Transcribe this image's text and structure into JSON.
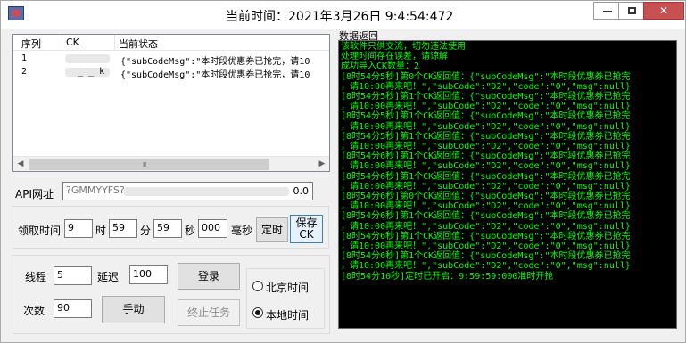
{
  "titlebar": {
    "title": "当前时间：2021年3月26日   9:4:54:472",
    "minimize_label": "",
    "maximize_label": "",
    "close_label": "✕"
  },
  "listview": {
    "columns": [
      "序列",
      "CK",
      "当前状态"
    ],
    "rows": [
      {
        "index": "1",
        "ck": "",
        "status": "{\"subCodeMsg\":\"本时段优惠券已抢完，请10"
      },
      {
        "index": "2",
        "ck": "_ _ k",
        "status": "{\"subCodeMsg\":\"本时段优惠券已抢完，请10"
      }
    ],
    "scroll_grip": "III"
  },
  "api": {
    "label": "API网址",
    "value_prefix": "?GMMYYFS?",
    "value_suffix": "0.0"
  },
  "timer": {
    "label": "领取时间",
    "hour_value": "9",
    "hour_unit": "时",
    "minute_value": "59",
    "minute_unit": "分",
    "second_value": "59",
    "second_unit": "秒",
    "ms_value": "000",
    "ms_unit": "毫秒",
    "timer_button": "定时",
    "save_button_line1": "保存",
    "save_button_line2": "CK"
  },
  "settings": {
    "thread_label": "线程",
    "thread_value": "5",
    "delay_label": "延迟",
    "delay_value": "100",
    "count_label": "次数",
    "count_value": "90",
    "login_button": "登录",
    "manual_button": "手动",
    "stop_button": "终止任务"
  },
  "time_source": {
    "beijing_label": "北京时间",
    "local_label": "本地时间",
    "selected": "local"
  },
  "console": {
    "title": "数据返回",
    "lines": [
      "该软件只供交流，切勿违法使用",
      "处理时间存在误差，请谅解",
      "成功导入CK数量：2",
      "[8时54分5秒]第0个CK返回值：{\"subCodeMsg\":\"本时段优惠券已抢完",
      "，请10:00再来吧！\",\"subCode\":\"D2\",\"code\":\"0\",\"msg\":null}",
      "[8时54分5秒]第1个CK返回值：{\"subCodeMsg\":\"本时段优惠券已抢完",
      "，请10:00再来吧！\",\"subCode\":\"D2\",\"code\":\"0\",\"msg\":null}",
      "[8时54分5秒]第1个CK返回值：{\"subCodeMsg\":\"本时段优惠券已抢完",
      "，请10:00再来吧！\",\"subCode\":\"D2\",\"code\":\"0\",\"msg\":null}",
      "[8时54分5秒]第1个CK返回值：{\"subCodeMsg\":\"本时段优惠券已抢完",
      "，请10:00再来吧！\",\"subCode\":\"D2\",\"code\":\"0\",\"msg\":null}",
      "[8时54分6秒]第1个CK返回值：{\"subCodeMsg\":\"本时段优惠券已抢完",
      "，请10:00再来吧！\",\"subCode\":\"D2\",\"code\":\"0\",\"msg\":null}",
      "[8时54分6秒]第1个CK返回值：{\"subCodeMsg\":\"本时段优惠券已抢完",
      "，请10:00再来吧！\",\"subCode\":\"D2\",\"code\":\"0\",\"msg\":null}",
      "[8时54分6秒]第0个CK返回值：{\"subCodeMsg\":\"本时段优惠券已抢完",
      "，请10:00再来吧！\",\"subCode\":\"D2\",\"code\":\"0\",\"msg\":null}",
      "[8时54分6秒]第1个CK返回值：{\"subCodeMsg\":\"本时段优惠券已抢完",
      "，请10:00再来吧！\",\"subCode\":\"D2\",\"code\":\"0\",\"msg\":null}",
      "[8时54分6秒]第1个CK返回值：{\"subCodeMsg\":\"本时段优惠券已抢完",
      "，请10:00再来吧！\",\"subCode\":\"D2\",\"code\":\"0\",\"msg\":null}",
      "[8时54分6秒]第1个CK返回值：{\"subCodeMsg\":\"本时段优惠券已抢完",
      "，请10:00再来吧！\",\"subCode\":\"D2\",\"code\":\"0\",\"msg\":null}",
      "[8时54分10秒]定时已开启：9:59:59:000准时开抢"
    ],
    "text_color": "#00ff00",
    "background_color": "#000000"
  }
}
